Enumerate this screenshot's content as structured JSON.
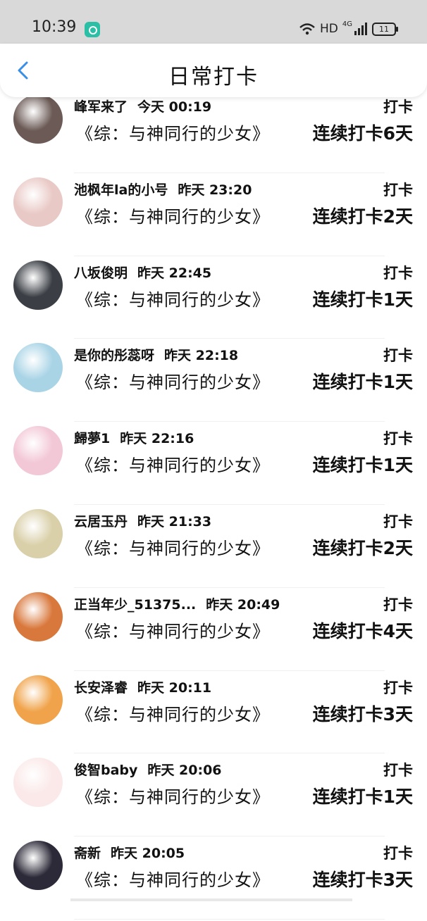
{
  "status_bar": {
    "time": "10:39",
    "network": "HD",
    "network_gen": "4G",
    "battery": "11"
  },
  "header": {
    "title": "日常打卡"
  },
  "colors": {
    "accent": "#3a8ee6",
    "status_bar_bg": "#d9d9d9"
  },
  "records": [
    {
      "name": "峰军来了",
      "time": "今天 00:19",
      "book": "《综：与神同行的少女》",
      "action": "打卡",
      "streak": "连续打卡6天",
      "avatar_color": "#6b5a55"
    },
    {
      "name": "池枫年la的小号",
      "time": "昨天 23:20",
      "book": "《综：与神同行的少女》",
      "action": "打卡",
      "streak": "连续打卡2天",
      "avatar_color": "#e9c9c6"
    },
    {
      "name": "八坂俊明",
      "time": "昨天 22:45",
      "book": "《综：与神同行的少女》",
      "action": "打卡",
      "streak": "连续打卡1天",
      "avatar_color": "#3b3f45"
    },
    {
      "name": "是你的彤蕊呀",
      "time": "昨天 22:18",
      "book": "《综：与神同行的少女》",
      "action": "打卡",
      "streak": "连续打卡1天",
      "avatar_color": "#a9d4e6"
    },
    {
      "name": "歸夢1",
      "time": "昨天 22:16",
      "book": "《综：与神同行的少女》",
      "action": "打卡",
      "streak": "连续打卡1天",
      "avatar_color": "#f3c8d6"
    },
    {
      "name": "云居玉丹",
      "time": "昨天 21:33",
      "book": "《综：与神同行的少女》",
      "action": "打卡",
      "streak": "连续打卡2天",
      "avatar_color": "#d9cfa8"
    },
    {
      "name": "正当年少_51375...",
      "time": "昨天 20:49",
      "book": "《综：与神同行的少女》",
      "action": "打卡",
      "streak": "连续打卡4天",
      "avatar_color": "#d9783c"
    },
    {
      "name": "长安泽睿",
      "time": "昨天 20:11",
      "book": "《综：与神同行的少女》",
      "action": "打卡",
      "streak": "连续打卡3天",
      "avatar_color": "#f0a34a"
    },
    {
      "name": "俊智baby",
      "time": "昨天 20:06",
      "book": "《综：与神同行的少女》",
      "action": "打卡",
      "streak": "连续打卡1天",
      "avatar_color": "#fbe9e9"
    },
    {
      "name": "斋新",
      "time": "昨天 20:05",
      "book": "《综：与神同行的少女》",
      "action": "打卡",
      "streak": "连续打卡3天",
      "avatar_color": "#2c2a38"
    }
  ]
}
